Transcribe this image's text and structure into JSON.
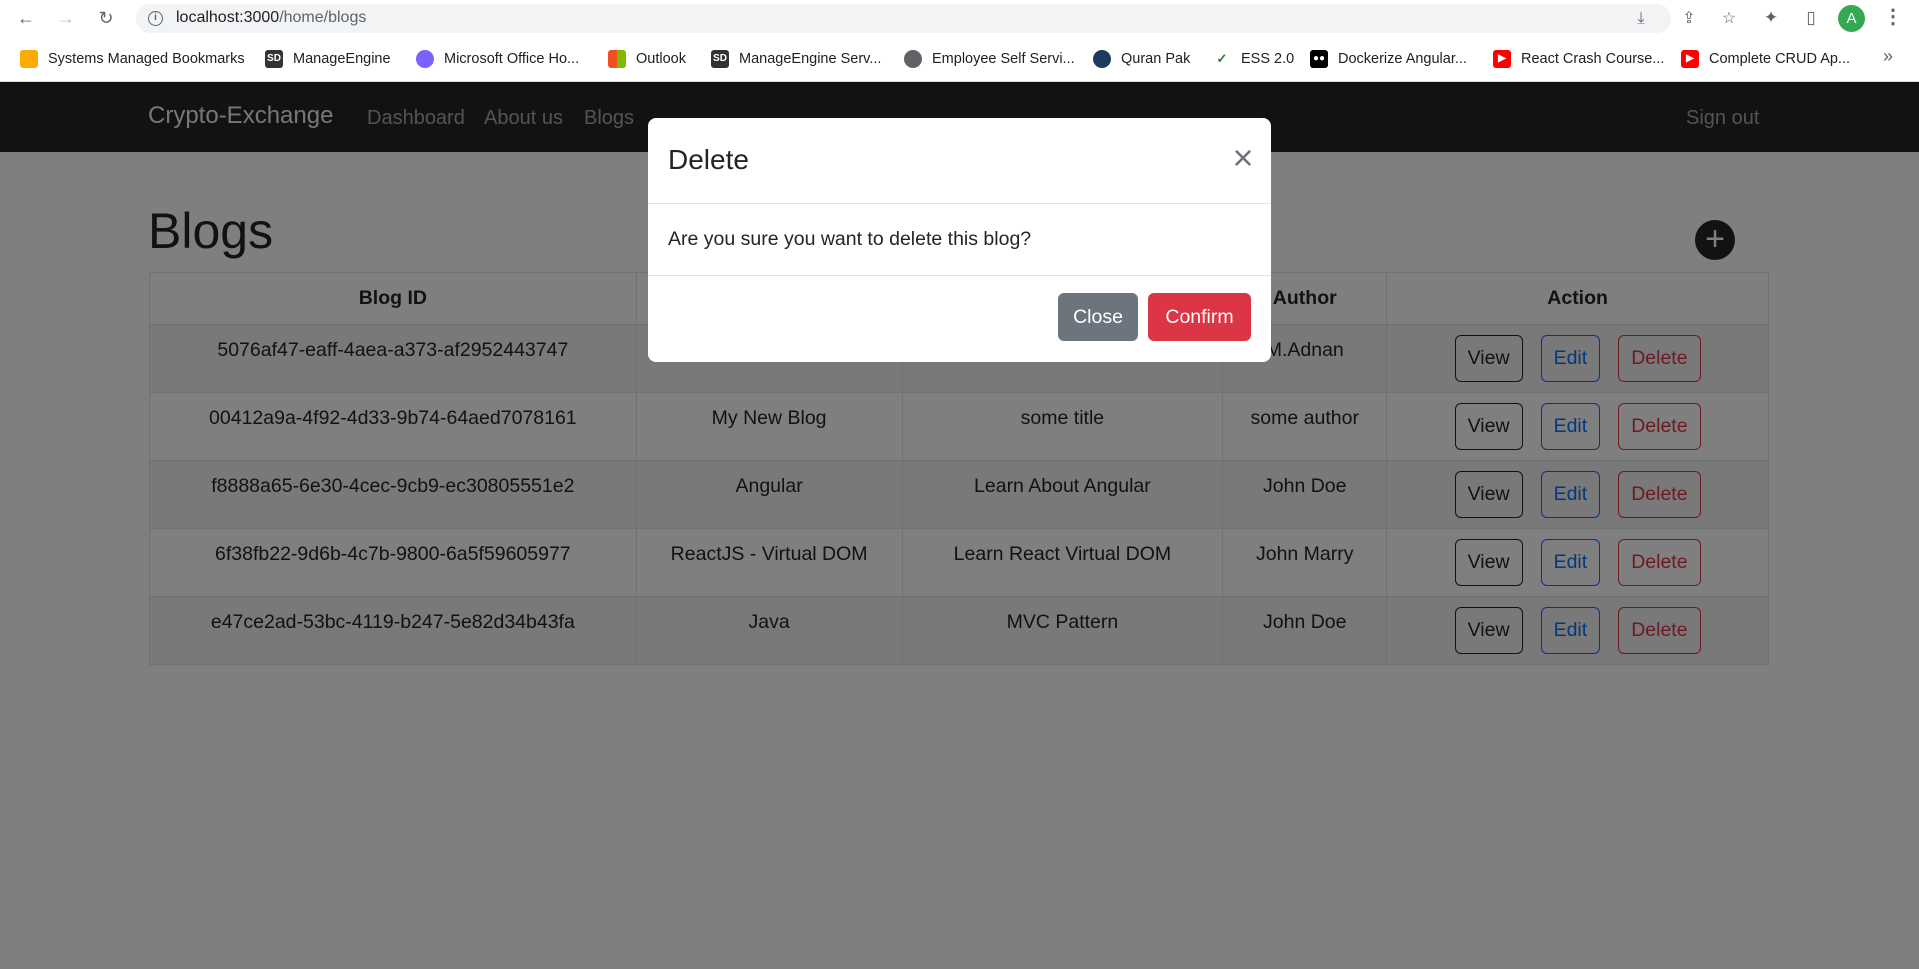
{
  "browser": {
    "url_host": "localhost:3000",
    "url_path": "/home/blogs",
    "avatar_letter": "A",
    "bookmarks": [
      {
        "label": "Systems Managed Bookmarks",
        "icon": "folder-icon",
        "color": "#f9ab00"
      },
      {
        "label": "ManageEngine",
        "icon": "sd-icon",
        "color": "#333333"
      },
      {
        "label": "Microsoft Office Ho...",
        "icon": "office-icon",
        "color": "#7b61ff"
      },
      {
        "label": "Outlook",
        "icon": "microsoft-icon",
        "color": "#f25022"
      },
      {
        "label": "ManageEngine Serv...",
        "icon": "sd-icon",
        "color": "#333333"
      },
      {
        "label": "Employee Self Servi...",
        "icon": "globe-icon",
        "color": "#5f6368"
      },
      {
        "label": "Quran Pak",
        "icon": "quran-icon",
        "color": "#1e3a5f"
      },
      {
        "label": "ESS 2.0",
        "icon": "ess-icon",
        "color": "#2e7d32"
      },
      {
        "label": "Dockerize Angular...",
        "icon": "medium-icon",
        "color": "#000000"
      },
      {
        "label": "React Crash Course...",
        "icon": "youtube-icon",
        "color": "#ff0000"
      },
      {
        "label": "Complete CRUD Ap...",
        "icon": "youtube-icon",
        "color": "#ff0000"
      }
    ]
  },
  "navbar": {
    "brand": "Crypto-Exchange",
    "links": [
      "Dashboard",
      "About us",
      "Blogs"
    ],
    "signout": "Sign out"
  },
  "page": {
    "title": "Blogs",
    "add_label": "+"
  },
  "table": {
    "headers": [
      "Blog ID",
      "",
      "",
      "Author",
      "Action"
    ],
    "rows": [
      {
        "id": "5076af47-eaff-4aea-a373-af2952443747",
        "name": "",
        "title": "",
        "author": "M.Adnan"
      },
      {
        "id": "00412a9a-4f92-4d33-9b74-64aed7078161",
        "name": "My New Blog",
        "title": "some title",
        "author": "some author"
      },
      {
        "id": "f8888a65-6e30-4cec-9cb9-ec30805551e2",
        "name": "Angular",
        "title": "Learn About Angular",
        "author": "John Doe"
      },
      {
        "id": "6f38fb22-9d6b-4c7b-9800-6a5f59605977",
        "name": "ReactJS - Virtual DOM",
        "title": "Learn React Virtual DOM",
        "author": "John Marry"
      },
      {
        "id": "e47ce2ad-53bc-4119-b247-5e82d34b43fa",
        "name": "Java",
        "title": "MVC Pattern",
        "author": "John Doe"
      }
    ],
    "actions": {
      "view": "View",
      "edit": "Edit",
      "delete": "Delete"
    }
  },
  "modal": {
    "title": "Delete",
    "close_icon": "close-icon",
    "body": "Are you sure you want to delete this blog?",
    "close_label": "Close",
    "confirm_label": "Confirm"
  },
  "colors": {
    "navbar_bg": "#212529",
    "danger": "#dc3545",
    "primary": "#0d6efd",
    "secondary": "#6c757d"
  }
}
